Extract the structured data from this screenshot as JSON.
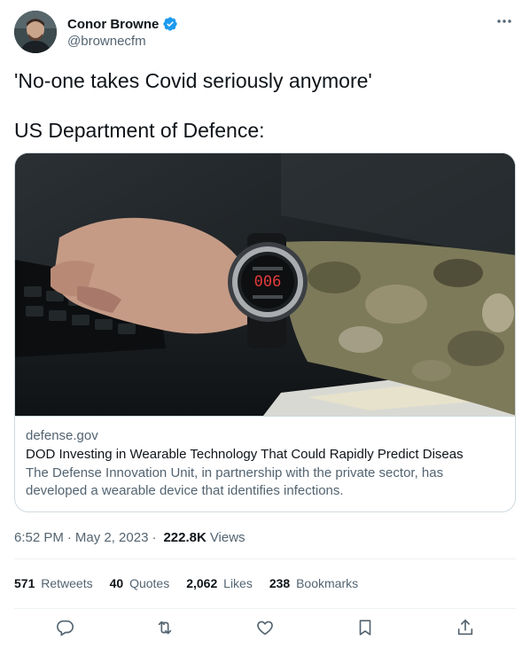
{
  "author": {
    "name": "Conor Browne",
    "handle": "@brownecfm",
    "verified": true,
    "avatar": "avatar"
  },
  "tweet": {
    "line1": "'No-one takes Covid seriously anymore'",
    "line2": "US Department of Defence:"
  },
  "card": {
    "image": "photo-smartwatch-on-wrist",
    "domain": "defense.gov",
    "title": "DOD Investing in Wearable Technology That Could Rapidly Predict Diseas",
    "description": "The Defense Innovation Unit, in partnership with the private sector, has developed a wearable device that identifies infections.",
    "watch_text": "006"
  },
  "meta": {
    "time": "6:52 PM",
    "date": "May 2, 2023",
    "separator": "·",
    "views_count": "222.8K",
    "views_label": "Views"
  },
  "stats": [
    {
      "count": "571",
      "label": "Retweets"
    },
    {
      "count": "40",
      "label": "Quotes"
    },
    {
      "count": "2,062",
      "label": "Likes"
    },
    {
      "count": "238",
      "label": "Bookmarks"
    }
  ],
  "actions": [
    "reply-icon",
    "retweet-icon",
    "like-icon",
    "bookmark-icon",
    "share-icon"
  ],
  "colors": {
    "verified": "#1d9bf0",
    "text": "#0f1419",
    "secondary": "#536471",
    "border": "#cfd9de",
    "divider": "#eff3f4"
  }
}
